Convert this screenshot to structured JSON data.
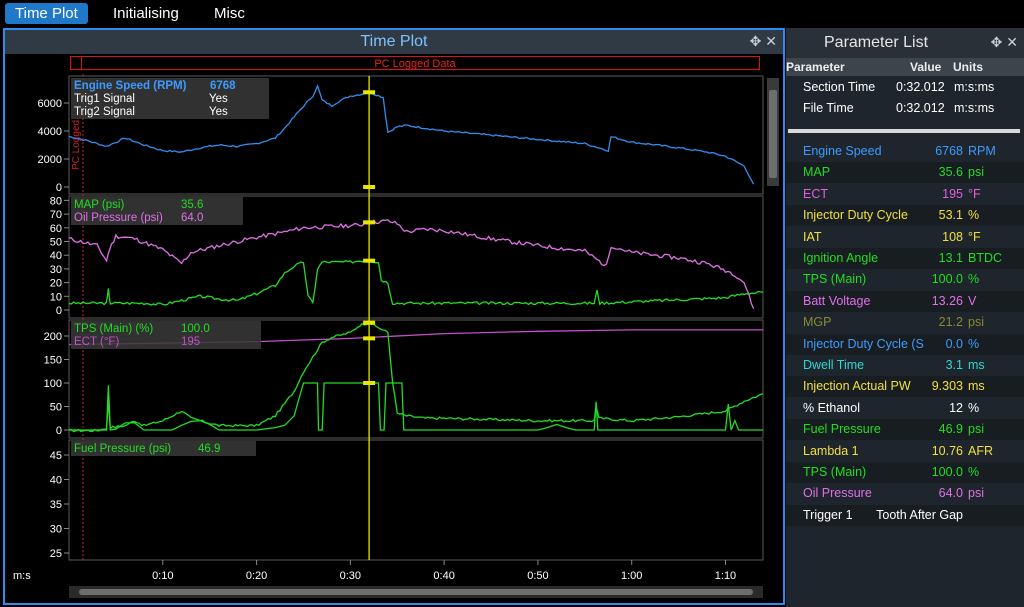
{
  "tabs": [
    {
      "label": "Time Plot"
    },
    {
      "label": "Initialising"
    },
    {
      "label": "Misc"
    }
  ],
  "time_plot": {
    "title": "Time Plot",
    "pc_logged_label": "PC Logged Data",
    "pc_logged_vertical": "PC Logged",
    "x_unit": "m:s",
    "x_ticks": [
      "0:10",
      "0:20",
      "0:30",
      "0:40",
      "0:50",
      "1:00",
      "1:10"
    ],
    "cursor_time_s": 32,
    "colors": {
      "rpm": "#2f8ff0",
      "map": "#22dd22",
      "oil": "#e070e8",
      "tps": "#22dd22",
      "ect": "#c34fc9",
      "fuel": "#22dd22",
      "cursor": "#e6e600"
    },
    "panes": [
      {
        "legend": [
          {
            "name": "Engine Speed (RPM)",
            "value": "6768",
            "color": "#3d9bff"
          },
          {
            "name": "Trig1 Signal",
            "value": "Yes",
            "color": "#ffffff"
          },
          {
            "name": "Trig2 Signal",
            "value": "Yes",
            "color": "#ffffff"
          }
        ],
        "y_ticks": [
          "6000",
          "4000",
          "2000",
          "0"
        ]
      },
      {
        "legend": [
          {
            "name": "MAP (psi)",
            "value": "35.6",
            "color": "#22dd22"
          },
          {
            "name": "Oil Pressure (psi)",
            "value": "64.0",
            "color": "#e070e8"
          }
        ],
        "y_ticks": [
          "80",
          "70",
          "60",
          "50",
          "40",
          "30",
          "20",
          "10",
          "0"
        ]
      },
      {
        "legend": [
          {
            "name": "TPS (Main) (%)",
            "value": "100.0",
            "color": "#22dd22"
          },
          {
            "name": "ECT (°F)",
            "value": "195",
            "color": "#c34fc9"
          }
        ],
        "y_ticks": [
          "200",
          "150",
          "100",
          "50",
          "0"
        ]
      },
      {
        "legend": [
          {
            "name": "Fuel Pressure (psi)",
            "value": "46.9",
            "color": "#22dd22"
          }
        ],
        "y_ticks": [
          "45",
          "40",
          "35",
          "30",
          "25"
        ]
      }
    ]
  },
  "parameter_list": {
    "title": "Parameter List",
    "columns": {
      "parameter": "Parameter",
      "value": "Value",
      "units": "Units"
    },
    "time_rows": [
      {
        "name": "Section Time",
        "value": "0:32.012",
        "units": "m:s:ms"
      },
      {
        "name": "File Time",
        "value": "0:32.012",
        "units": "m:s:ms"
      }
    ],
    "rows": [
      {
        "name": "Engine Speed",
        "value": "6768",
        "units": "RPM",
        "color": "#3d9bff"
      },
      {
        "name": "MAP",
        "value": "35.6",
        "units": "psi",
        "color": "#22dd22"
      },
      {
        "name": "ECT",
        "value": "195",
        "units": "°F",
        "color": "#e060e0"
      },
      {
        "name": "Injector Duty Cycle",
        "value": "53.1",
        "units": "%",
        "color": "#f0e040"
      },
      {
        "name": "IAT",
        "value": "108",
        "units": "°F",
        "color": "#f0e040"
      },
      {
        "name": "Ignition Angle",
        "value": "13.1",
        "units": "BTDC",
        "color": "#22dd22"
      },
      {
        "name": "TPS (Main)",
        "value": "100.0",
        "units": "%",
        "color": "#22dd22"
      },
      {
        "name": "Batt Voltage",
        "value": "13.26",
        "units": "V",
        "color": "#e070e8"
      },
      {
        "name": "MGP",
        "value": "21.2",
        "units": "psi",
        "color": "#8a8a30"
      },
      {
        "name": "Injector Duty Cycle (S",
        "value": "0.0",
        "units": "%",
        "color": "#3d9bff"
      },
      {
        "name": "Dwell Time",
        "value": "3.1",
        "units": "ms",
        "color": "#30d8d8"
      },
      {
        "name": "Injection Actual PW",
        "value": "9.303",
        "units": "ms",
        "color": "#f0e040"
      },
      {
        "name": "% Ethanol",
        "value": "12",
        "units": "%",
        "color": "#ffffff"
      },
      {
        "name": "Fuel Pressure",
        "value": "46.9",
        "units": "psi",
        "color": "#22dd22"
      },
      {
        "name": "Lambda 1",
        "value": "10.76",
        "units": "AFR",
        "color": "#f0e040"
      },
      {
        "name": "TPS (Main)",
        "value": "100.0",
        "units": "%",
        "color": "#22dd22"
      },
      {
        "name": "Oil Pressure",
        "value": "64.0",
        "units": "psi",
        "color": "#e070e8"
      },
      {
        "name": "Trigger 1",
        "value": "Tooth After Gap",
        "units": "",
        "color": "#ffffff"
      }
    ]
  }
}
